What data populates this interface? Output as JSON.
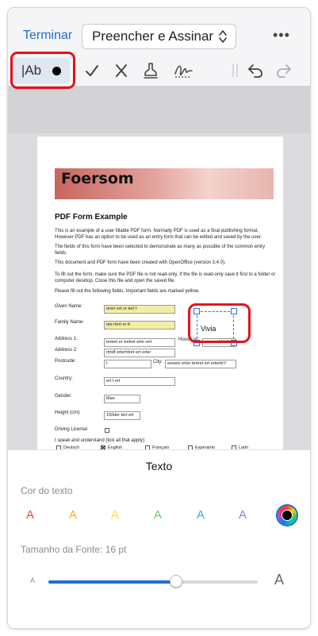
{
  "nav": {
    "done_label": "Terminar",
    "mode_label": "Preencher e Assinar",
    "more_icon": "more-horizontal-icon"
  },
  "toolbar": {
    "text_tool_label": "|Ab",
    "icons": [
      "text-tool-icon",
      "color-dot-icon",
      "checkmark-icon",
      "cross-icon",
      "stamp-icon",
      "signature-icon",
      "undo-icon",
      "redo-icon"
    ]
  },
  "document": {
    "logo": "Foersom",
    "title": "PDF Form Example",
    "paragraphs": [
      "This is an example of a user fillable PDF form. Normally PDF is used as a final publishing format. However PDF has an option to be used as an entry form that can be edited and saved by the user.",
      "The fields of this form have been selected to demonstrate as many as possible of the common entry fields.",
      "This document and PDF form have been created with OpenOffice (version 3.4.0).",
      "To fill out the form, make sure the PDF file is not read-only. If the file is read-only save it first to a folder or computer desktop. Close this file and open the saved file.",
      "Please fill out the following fields. Important fields are marked yellow."
    ],
    "fields": {
      "given_name_label": "Given Name:",
      "given_name_value": "ererr ert re tert t",
      "family_name_label": "Family Name:",
      "family_name_value": "ete rtert er tt",
      "address1_label": "Address 1:",
      "address1_value": "tertert er tretret  erte rert",
      "house_label": "House nr:",
      "house_value": "ewrewd fdsf w",
      "address2_label": "Address 2:",
      "address2_value": "rtrtdf ertertrtret ert erter",
      "postcode_label": "Postcode:",
      "postcode_value": "t",
      "city_label": "City:",
      "city_value": "erewrs erter tertret ert ertertd f",
      "country_label": "Country:",
      "country_value": "ert t ert",
      "gender_label": "Gender:",
      "gender_value": "Man",
      "height_label": "Height (cm):",
      "height_value": "150der tert ert",
      "driving_label": "Driving License:",
      "languages_label": "I speak and understand (tick all that apply):",
      "languages": [
        "Deutsch",
        "English",
        "Français",
        "Esperanto",
        "Latin"
      ]
    },
    "signature_text": "Vivia"
  },
  "sheet": {
    "title": "Texto",
    "color_label": "Cor do texto",
    "swatch_letter": "A",
    "swatch_colors": [
      "#ff3b30",
      "#ffb300",
      "#ffe11a",
      "#5fd46b",
      "#27b5d4",
      "#8e7ee8"
    ],
    "selected_color": "#000000",
    "font_size_label": "Tamanho da Fonte: 16 pt",
    "slider_small_label": "A",
    "slider_large_label": "A",
    "font_size_fraction": 0.61
  }
}
